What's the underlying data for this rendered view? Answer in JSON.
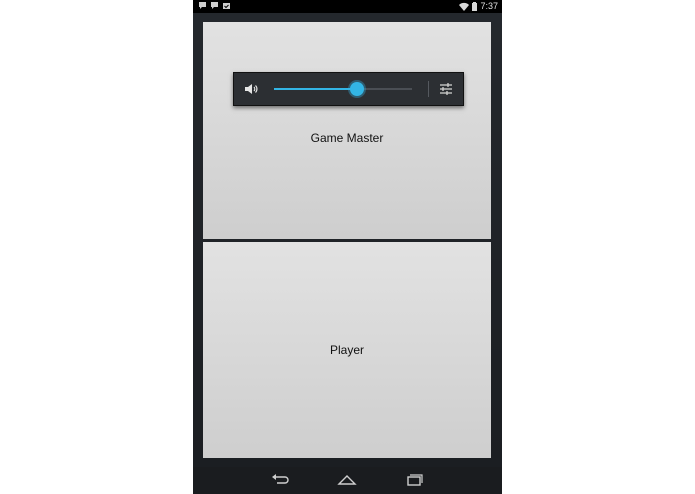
{
  "statusbar": {
    "time": "7:37",
    "notification_icons": [
      "chat-bubble-icon",
      "chat-bubble-icon",
      "calendar-check-icon"
    ],
    "system_icons": [
      "wifi-icon",
      "battery-icon"
    ]
  },
  "volume_panel": {
    "level": 0.6,
    "accent_color": "#33b5e5",
    "icons": [
      "speaker-icon",
      "equalizer-settings-icon"
    ]
  },
  "panels": {
    "game_master_label": "Game Master",
    "player_label": "Player"
  },
  "navbar": {
    "icons": [
      "back-icon",
      "home-icon",
      "recent-apps-icon"
    ]
  }
}
